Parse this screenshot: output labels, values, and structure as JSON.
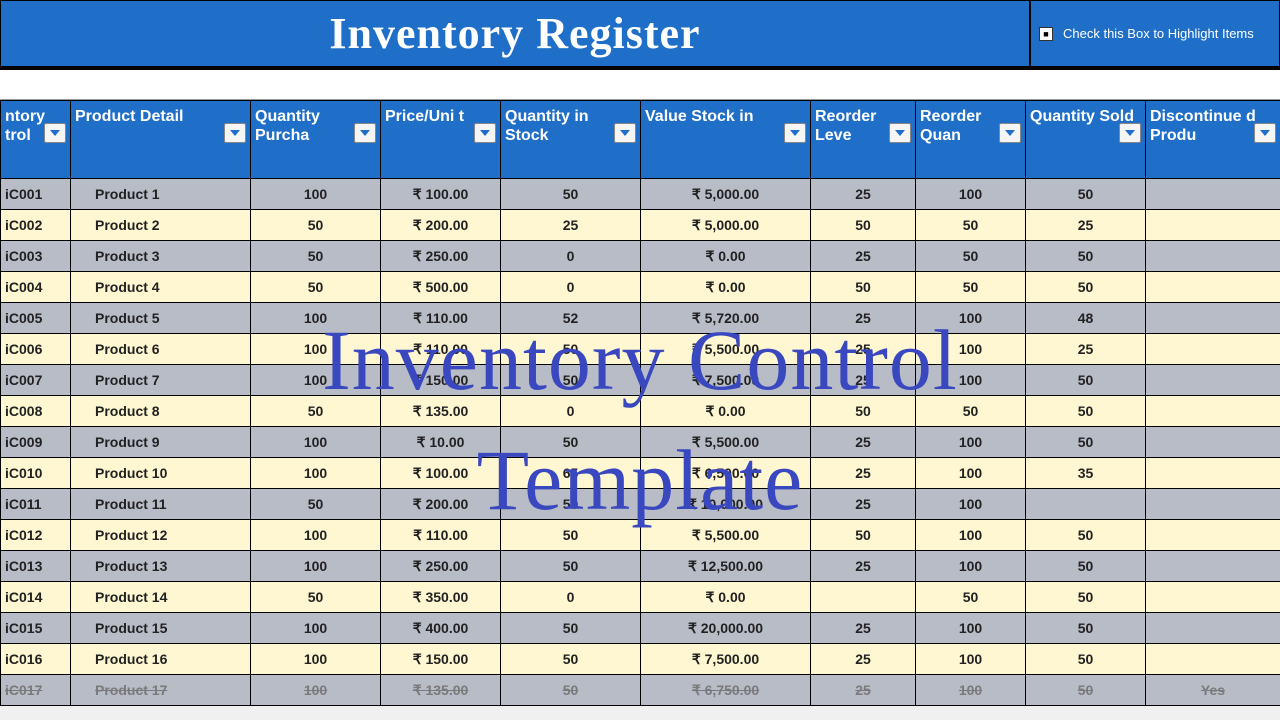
{
  "header": {
    "title": "Inventory Register",
    "checkbox_hint": "Check this Box to Highlight Items"
  },
  "watermark": {
    "line1": "Inventory Control",
    "line2": "Template"
  },
  "columns": [
    {
      "label": "ntory\ntrol"
    },
    {
      "label": "Product Detail"
    },
    {
      "label": "Quantity Purcha"
    },
    {
      "label": "Price/Uni t"
    },
    {
      "label": "Quantity in Stock"
    },
    {
      "label": "Value Stock in"
    },
    {
      "label": "Reorder Leve"
    },
    {
      "label": "Reorder Quan"
    },
    {
      "label": "Quantity Sold"
    },
    {
      "label": "Discontinue d Produ"
    }
  ],
  "rows": [
    {
      "ctrl": "iC001",
      "prod": "Product 1",
      "qp": "100",
      "pu": "₹ 100.00",
      "qs": "50",
      "val": "₹ 5,000.00",
      "rl": "25",
      "rq": "100",
      "sold": "50",
      "disc": "",
      "style": "even"
    },
    {
      "ctrl": "iC002",
      "prod": "Product 2",
      "qp": "50",
      "pu": "₹ 200.00",
      "qs": "25",
      "val": "₹ 5,000.00",
      "rl": "50",
      "rq": "50",
      "sold": "25",
      "disc": "",
      "style": "odd"
    },
    {
      "ctrl": "iC003",
      "prod": "Product 3",
      "qp": "50",
      "pu": "₹ 250.00",
      "qs": "0",
      "val": "₹ 0.00",
      "rl": "25",
      "rq": "50",
      "sold": "50",
      "disc": "",
      "style": "even"
    },
    {
      "ctrl": "iC004",
      "prod": "Product 4",
      "qp": "50",
      "pu": "₹ 500.00",
      "qs": "0",
      "val": "₹ 0.00",
      "rl": "50",
      "rq": "50",
      "sold": "50",
      "disc": "",
      "style": "odd"
    },
    {
      "ctrl": "iC005",
      "prod": "Product 5",
      "qp": "100",
      "pu": "₹ 110.00",
      "qs": "52",
      "val": "₹ 5,720.00",
      "rl": "25",
      "rq": "100",
      "sold": "48",
      "disc": "",
      "style": "even"
    },
    {
      "ctrl": "iC006",
      "prod": "Product 6",
      "qp": "100",
      "pu": "₹ 110.00",
      "qs": "50",
      "val": "₹ 5,500.00",
      "rl": "25",
      "rq": "100",
      "sold": "25",
      "disc": "",
      "style": "odd"
    },
    {
      "ctrl": "iC007",
      "prod": "Product 7",
      "qp": "100",
      "pu": "₹ 150.00",
      "qs": "50",
      "val": "₹ 7,500.00",
      "rl": "25",
      "rq": "100",
      "sold": "50",
      "disc": "",
      "style": "even"
    },
    {
      "ctrl": "iC008",
      "prod": "Product 8",
      "qp": "50",
      "pu": "₹ 135.00",
      "qs": "0",
      "val": "₹ 0.00",
      "rl": "50",
      "rq": "50",
      "sold": "50",
      "disc": "",
      "style": "odd"
    },
    {
      "ctrl": "iC009",
      "prod": "Product 9",
      "qp": "100",
      "pu": "₹ 10.00",
      "qs": "50",
      "val": "₹ 5,500.00",
      "rl": "25",
      "rq": "100",
      "sold": "50",
      "disc": "",
      "style": "even"
    },
    {
      "ctrl": "iC010",
      "prod": "Product 10",
      "qp": "100",
      "pu": "₹ 100.00",
      "qs": "65",
      "val": "₹ 6,500.00",
      "rl": "25",
      "rq": "100",
      "sold": "35",
      "disc": "",
      "style": "odd"
    },
    {
      "ctrl": "iC011",
      "prod": "Product 11",
      "qp": "50",
      "pu": "₹ 200.00",
      "qs": "50",
      "val": "₹ 10,000.00",
      "rl": "25",
      "rq": "100",
      "sold": "",
      "disc": "",
      "style": "even"
    },
    {
      "ctrl": "iC012",
      "prod": "Product 12",
      "qp": "100",
      "pu": "₹ 110.00",
      "qs": "50",
      "val": "₹ 5,500.00",
      "rl": "50",
      "rq": "100",
      "sold": "50",
      "disc": "",
      "style": "odd"
    },
    {
      "ctrl": "iC013",
      "prod": "Product 13",
      "qp": "100",
      "pu": "₹ 250.00",
      "qs": "50",
      "val": "₹ 12,500.00",
      "rl": "25",
      "rq": "100",
      "sold": "50",
      "disc": "",
      "style": "even"
    },
    {
      "ctrl": "iC014",
      "prod": "Product 14",
      "qp": "50",
      "pu": "₹ 350.00",
      "qs": "0",
      "val": "₹ 0.00",
      "rl": "",
      "rq": "50",
      "sold": "50",
      "disc": "",
      "style": "odd"
    },
    {
      "ctrl": "iC015",
      "prod": "Product 15",
      "qp": "100",
      "pu": "₹ 400.00",
      "qs": "50",
      "val": "₹ 20,000.00",
      "rl": "25",
      "rq": "100",
      "sold": "50",
      "disc": "",
      "style": "even"
    },
    {
      "ctrl": "iC016",
      "prod": "Product 16",
      "qp": "100",
      "pu": "₹ 150.00",
      "qs": "50",
      "val": "₹ 7,500.00",
      "rl": "25",
      "rq": "100",
      "sold": "50",
      "disc": "",
      "style": "odd"
    },
    {
      "ctrl": "iC017",
      "prod": "Product 17",
      "qp": "100",
      "pu": "₹ 135.00",
      "qs": "50",
      "val": "₹ 6,750.00",
      "rl": "25",
      "rq": "100",
      "sold": "50",
      "disc": "Yes",
      "style": "disc"
    }
  ]
}
